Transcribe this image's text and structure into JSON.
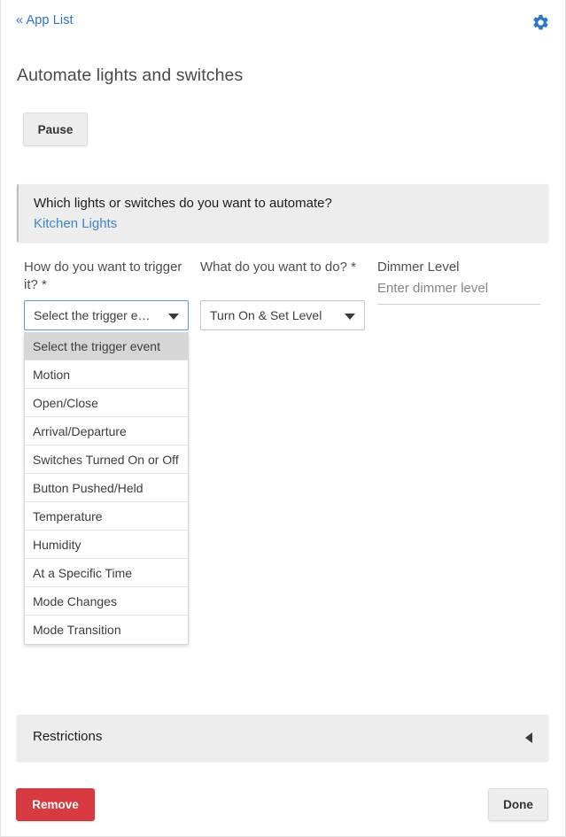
{
  "topbar": {
    "back_link": "« App List",
    "gear_icon": "gear-icon",
    "gear_color": "#2b78c6"
  },
  "header": {
    "title": "Automate lights and switches"
  },
  "toolbar": {
    "pause_label": "Pause"
  },
  "device_section": {
    "question": "Which lights or switches do you want to automate?",
    "selected_device": "Kitchen Lights"
  },
  "form": {
    "trigger": {
      "label": "How do you want to trigger it? *",
      "selected": "Select the trigger e…",
      "caret_icon": "chevron-down-icon",
      "focused": true,
      "options": [
        {
          "label": "Select the trigger event",
          "highlighted": true
        },
        {
          "label": "Motion",
          "highlighted": false
        },
        {
          "label": "Open/Close",
          "highlighted": false
        },
        {
          "label": "Arrival/Departure",
          "highlighted": false
        },
        {
          "label": "Switches Turned On or Off",
          "highlighted": false
        },
        {
          "label": "Button Pushed/Held",
          "highlighted": false
        },
        {
          "label": "Temperature",
          "highlighted": false
        },
        {
          "label": "Humidity",
          "highlighted": false
        },
        {
          "label": "At a Specific Time",
          "highlighted": false
        },
        {
          "label": "Mode Changes",
          "highlighted": false
        },
        {
          "label": "Mode Transition",
          "highlighted": false
        }
      ]
    },
    "action": {
      "label": "What do you want to do? *",
      "selected": "Turn On & Set Level",
      "caret_icon": "chevron-down-icon"
    },
    "dimmer": {
      "label": "Dimmer Level",
      "value": "",
      "placeholder": "Enter dimmer level"
    }
  },
  "restrictions": {
    "label": "Restrictions",
    "arrow_icon": "chevron-left-icon",
    "expanded": false
  },
  "footer": {
    "remove_label": "Remove",
    "remove_color": "#d73b41",
    "done_label": "Done"
  }
}
